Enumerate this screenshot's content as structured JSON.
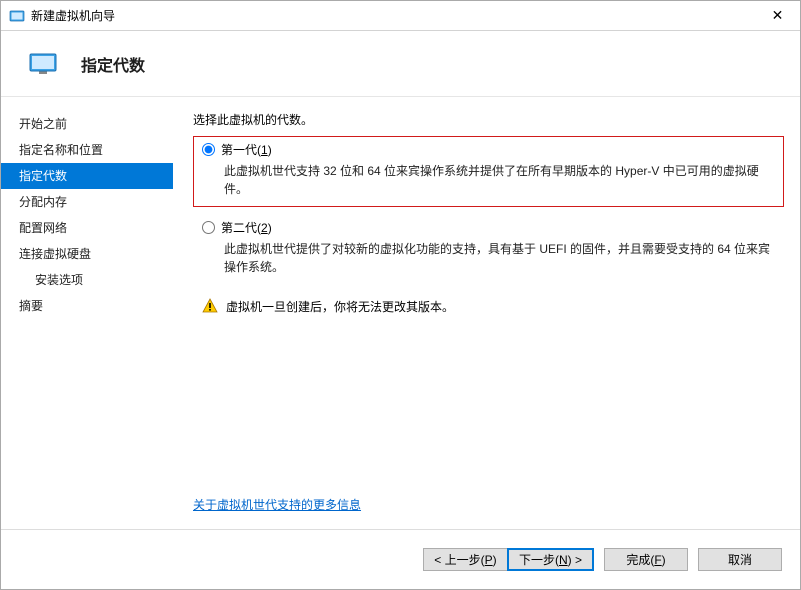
{
  "window": {
    "title": "新建虚拟机向导",
    "close_glyph": "✕"
  },
  "header": {
    "title": "指定代数"
  },
  "sidebar": {
    "steps": [
      {
        "label": "开始之前"
      },
      {
        "label": "指定名称和位置"
      },
      {
        "label": "指定代数"
      },
      {
        "label": "分配内存"
      },
      {
        "label": "配置网络"
      },
      {
        "label": "连接虚拟硬盘"
      },
      {
        "label": "安装选项"
      },
      {
        "label": "摘要"
      }
    ]
  },
  "content": {
    "instruction": "选择此虚拟机的代数。",
    "option1": {
      "label_prefix": "第一代(",
      "mnemonic": "1",
      "label_suffix": ")",
      "description": "此虚拟机世代支持 32 位和 64 位来宾操作系统并提供了在所有早期版本的 Hyper-V 中已可用的虚拟硬件。"
    },
    "option2": {
      "label_prefix": "第二代(",
      "mnemonic": "2",
      "label_suffix": ")",
      "description": "此虚拟机世代提供了对较新的虚拟化功能的支持，具有基于 UEFI 的固件，并且需要受支持的 64 位来宾操作系统。"
    },
    "warning": "虚拟机一旦创建后，你将无法更改其版本。",
    "link": "关于虚拟机世代支持的更多信息"
  },
  "footer": {
    "prev_prefix": "< 上一步(",
    "prev_mnemonic": "P",
    "prev_suffix": ")",
    "next_prefix": "下一步(",
    "next_mnemonic": "N",
    "next_suffix": ") >",
    "finish_prefix": "完成(",
    "finish_mnemonic": "F",
    "finish_suffix": ")",
    "cancel": "取消"
  },
  "colors": {
    "accent": "#0078d7",
    "highlight_border": "#d11a1a",
    "link": "#0066cc"
  }
}
